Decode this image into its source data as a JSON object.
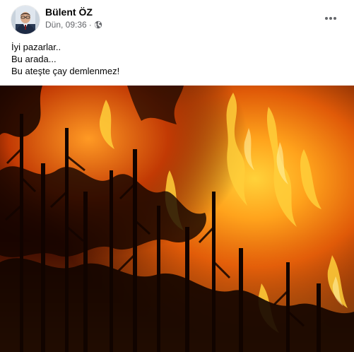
{
  "post": {
    "author": "Bülent ÖZ",
    "timestamp": "Dün, 09:36",
    "separator": "·",
    "privacy_icon": "globe-icon",
    "more_icon": "more-options-icon",
    "text_lines": [
      "İyi pazarlar..",
      "Bu arada...",
      "Bu ateşte çay demlenmez!"
    ],
    "image": {
      "subject": "forest-fire-photo"
    }
  },
  "colors": {
    "author_text": "#050505",
    "meta_text": "#65676b",
    "flame_bright": "#ffd23a",
    "flame_mid": "#f07a10",
    "flame_dark": "#a82400",
    "tree_silhouette": "#120400"
  }
}
